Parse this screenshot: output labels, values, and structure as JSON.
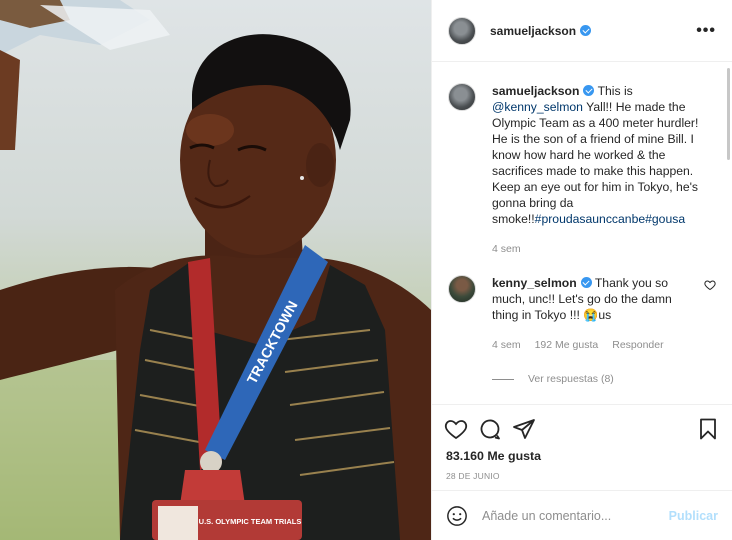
{
  "post": {
    "author": "samueljackson",
    "verified": true,
    "more_icon": "•••"
  },
  "caption": {
    "username": "samueljackson",
    "mention": "@kenny_selmon",
    "text": " Yall!! He made the Olympic Team as a 400 meter hurdler! He is the son of a friend of mine Bill. I know how hard he worked & the sacrifices made to make this happen. Keep an eye out for him in Tokyo, he's gonna bring da smoke!!",
    "lead": "This is",
    "hashtags": "#proudasaunccanbe#gousa",
    "time": "4 sem"
  },
  "comment": {
    "username": "kenny_selmon",
    "text": "Thank you so much, unc!! Let's go do the damn thing in Tokyo !!! 😭us",
    "time": "4 sem",
    "likes": "192 Me gusta",
    "reply": "Responder",
    "view_replies": "Ver respuestas (8)"
  },
  "photo": {
    "bib_text": "TRACKTOWN",
    "badge_text": "U.S. OLYMPIC TEAM TRIALS"
  },
  "stats": {
    "likes": "83.160 Me gusta",
    "date": "28 DE JUNIO"
  },
  "composer": {
    "placeholder": "Añade un comentario...",
    "publish": "Publicar"
  },
  "colors": {
    "accent": "#3897f0",
    "link": "#00376b",
    "publish_disabled": "#b2dffc"
  }
}
